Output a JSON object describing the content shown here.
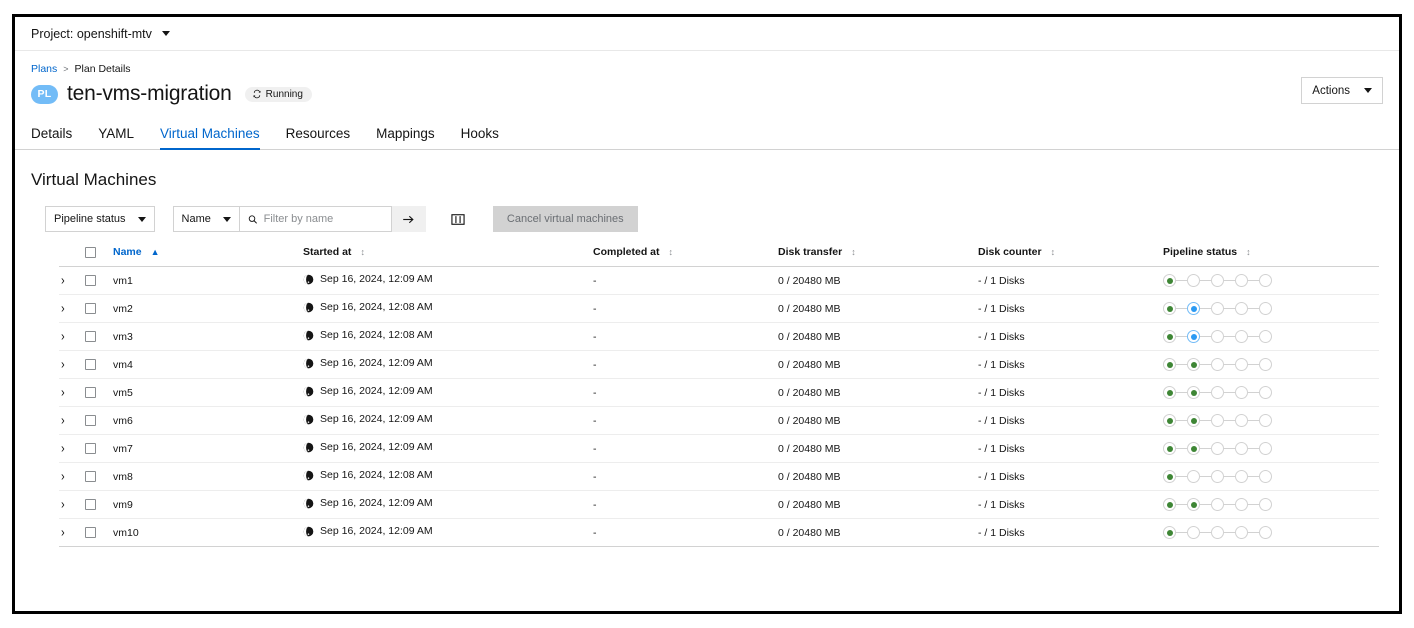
{
  "project_bar": {
    "label": "Project: openshift-mtv",
    "caret_icon": "chevron-down-icon"
  },
  "header": {
    "breadcrumb": {
      "root": "Plans",
      "separator": ">",
      "current": "Plan Details"
    },
    "badge": "PL",
    "title": "ten-vms-migration",
    "status": {
      "label": "Running",
      "icon": "sync-icon"
    },
    "actions_button": {
      "label": "Actions",
      "caret_icon": "chevron-down-icon"
    }
  },
  "tabs": [
    {
      "label": "Details",
      "active": false
    },
    {
      "label": "YAML",
      "active": false
    },
    {
      "label": "Virtual Machines",
      "active": true
    },
    {
      "label": "Resources",
      "active": false
    },
    {
      "label": "Mappings",
      "active": false
    },
    {
      "label": "Hooks",
      "active": false
    }
  ],
  "section": {
    "title": "Virtual Machines"
  },
  "toolbar": {
    "status_filter": {
      "label": "Pipeline status",
      "caret_icon": "chevron-down-icon"
    },
    "attribute_filter": {
      "label": "Name",
      "caret_icon": "chevron-down-icon"
    },
    "search": {
      "placeholder": "Filter by name",
      "value": "",
      "icon": "search-icon"
    },
    "submit_button": {
      "icon": "arrow-right-icon"
    },
    "columns_button": {
      "icon": "columns-icon"
    },
    "cancel_button": {
      "label": "Cancel virtual machines",
      "disabled": true
    }
  },
  "table": {
    "columns": [
      {
        "key": "name",
        "label": "Name",
        "sort": "asc",
        "sort_icon": "sort-asc-icon"
      },
      {
        "key": "started",
        "label": "Started at",
        "sort": "none",
        "sort_icon": "sort-icon"
      },
      {
        "key": "completed",
        "label": "Completed at",
        "sort": "none",
        "sort_icon": "sort-icon"
      },
      {
        "key": "disk_transfer",
        "label": "Disk transfer",
        "sort": "none",
        "sort_icon": "sort-icon"
      },
      {
        "key": "disk_counter",
        "label": "Disk counter",
        "sort": "none",
        "sort_icon": "sort-icon"
      },
      {
        "key": "pipeline",
        "label": "Pipeline status",
        "sort": "none",
        "sort_icon": "sort-icon"
      }
    ],
    "rows": [
      {
        "name": "vm1",
        "started": "Sep 16, 2024, 12:09 AM",
        "completed": "-",
        "disk_transfer": "0 / 20480 MB",
        "disk_counter": "- / 1 Disks",
        "pipeline": [
          "done",
          "pending",
          "pending",
          "pending",
          "pending"
        ]
      },
      {
        "name": "vm2",
        "started": "Sep 16, 2024, 12:08 AM",
        "completed": "-",
        "disk_transfer": "0 / 20480 MB",
        "disk_counter": "- / 1 Disks",
        "pipeline": [
          "done",
          "running",
          "pending",
          "pending",
          "pending"
        ]
      },
      {
        "name": "vm3",
        "started": "Sep 16, 2024, 12:08 AM",
        "completed": "-",
        "disk_transfer": "0 / 20480 MB",
        "disk_counter": "- / 1 Disks",
        "pipeline": [
          "done",
          "running",
          "pending",
          "pending",
          "pending"
        ]
      },
      {
        "name": "vm4",
        "started": "Sep 16, 2024, 12:09 AM",
        "completed": "-",
        "disk_transfer": "0 / 20480 MB",
        "disk_counter": "- / 1 Disks",
        "pipeline": [
          "done",
          "done",
          "pending",
          "pending",
          "pending"
        ]
      },
      {
        "name": "vm5",
        "started": "Sep 16, 2024, 12:09 AM",
        "completed": "-",
        "disk_transfer": "0 / 20480 MB",
        "disk_counter": "- / 1 Disks",
        "pipeline": [
          "done",
          "done",
          "pending",
          "pending",
          "pending"
        ]
      },
      {
        "name": "vm6",
        "started": "Sep 16, 2024, 12:09 AM",
        "completed": "-",
        "disk_transfer": "0 / 20480 MB",
        "disk_counter": "- / 1 Disks",
        "pipeline": [
          "done",
          "done",
          "pending",
          "pending",
          "pending"
        ]
      },
      {
        "name": "vm7",
        "started": "Sep 16, 2024, 12:09 AM",
        "completed": "-",
        "disk_transfer": "0 / 20480 MB",
        "disk_counter": "- / 1 Disks",
        "pipeline": [
          "done",
          "done",
          "pending",
          "pending",
          "pending"
        ]
      },
      {
        "name": "vm8",
        "started": "Sep 16, 2024, 12:08 AM",
        "completed": "-",
        "disk_transfer": "0 / 20480 MB",
        "disk_counter": "- / 1 Disks",
        "pipeline": [
          "done",
          "pending",
          "pending",
          "pending",
          "pending"
        ]
      },
      {
        "name": "vm9",
        "started": "Sep 16, 2024, 12:09 AM",
        "completed": "-",
        "disk_transfer": "0 / 20480 MB",
        "disk_counter": "- / 1 Disks",
        "pipeline": [
          "done",
          "done",
          "pending",
          "pending",
          "pending"
        ]
      },
      {
        "name": "vm10",
        "started": "Sep 16, 2024, 12:09 AM",
        "completed": "-",
        "disk_transfer": "0 / 20480 MB",
        "disk_counter": "- / 1 Disks",
        "pipeline": [
          "done",
          "pending",
          "pending",
          "pending",
          "pending"
        ]
      }
    ]
  },
  "colors": {
    "link": "#0066cc",
    "pipeline_done": "#3e8635",
    "pipeline_running": "#2b9af3",
    "badge_bg": "#73bcf7",
    "border": "#d2d2d2"
  }
}
